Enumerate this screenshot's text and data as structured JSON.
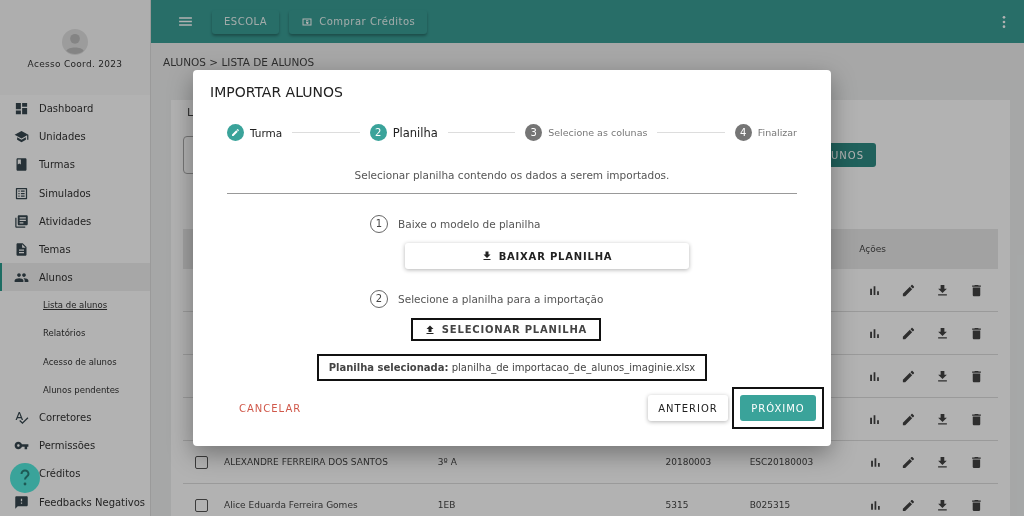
{
  "sidebar": {
    "user": "Acesso Coord. 2023",
    "items": [
      {
        "label": "Dashboard",
        "selected": false
      },
      {
        "label": "Unidades",
        "selected": false
      },
      {
        "label": "Turmas",
        "selected": false
      },
      {
        "label": "Simulados",
        "selected": false
      },
      {
        "label": "Atividades",
        "selected": false
      },
      {
        "label": "Temas",
        "selected": false
      },
      {
        "label": "Alunos",
        "selected": true,
        "children": [
          {
            "label": "Lista de alunos",
            "selected": true
          },
          {
            "label": "Relatórios",
            "selected": false
          },
          {
            "label": "Acesso de alunos",
            "selected": false
          },
          {
            "label": "Alunos pendentes",
            "selected": false
          }
        ]
      },
      {
        "label": "Corretores",
        "selected": false
      },
      {
        "label": "Permissões",
        "selected": false
      },
      {
        "label": "Créditos",
        "selected": false
      },
      {
        "label": "Feedbacks Negativos",
        "selected": false
      }
    ]
  },
  "topbar": {
    "buttons": [
      {
        "label": "ESCOLA",
        "kind": "plain"
      },
      {
        "label": "Comprar Créditos",
        "kind": "icon"
      }
    ]
  },
  "breadcrumb": "ALUNOS > LISTA DE ALUNOS",
  "card": {
    "title": "L",
    "action_button": "UNOS",
    "actions_header": "Ações",
    "rows": [
      {
        "kind": "covered"
      },
      {
        "kind": "covered"
      },
      {
        "kind": "covered"
      },
      {
        "kind": "covered"
      },
      {
        "kind": "full",
        "checked": false,
        "cells": [
          "ALEXANDRE FERREIRA DOS SANTOS",
          "3º A",
          "20180003",
          "ESC20180003"
        ]
      },
      {
        "kind": "full",
        "checked": false,
        "cells": [
          "Alice Eduarda Ferreira Gomes",
          "1EB",
          "5315",
          "B025315"
        ]
      }
    ]
  },
  "modal": {
    "title": "IMPORTAR ALUNOS",
    "steps": [
      {
        "label": "Turma",
        "completed": true,
        "selected": false
      },
      {
        "number": "2",
        "label": "Planilha",
        "completed": false,
        "selected": true
      },
      {
        "number": "3",
        "label": "Selecione as colunas",
        "completed": false,
        "selected": false
      },
      {
        "number": "4",
        "label": "Finalizar",
        "completed": false,
        "selected": false
      }
    ],
    "description": "Selecionar planilha contendo os dados a serem importados.",
    "instructions": [
      {
        "number": "1",
        "text": "Baixe o modelo de planilha",
        "button": "BAIXAR PLANILHA",
        "kind": "download",
        "highlighted": false
      },
      {
        "number": "2",
        "text": "Selecione a planilha para a importação",
        "button": "SELECIONAR PLANILHA",
        "kind": "upload",
        "highlighted": true
      }
    ],
    "selected_file": {
      "text": "**Planilha selecionada:** planilha_de importacao_de_alunos_imaginie.xlsx",
      "highlighted": true
    },
    "cancel": "CANCELAR",
    "previous": "ANTERIOR",
    "next": "PRÓXIMO",
    "next_highlighted": true
  }
}
